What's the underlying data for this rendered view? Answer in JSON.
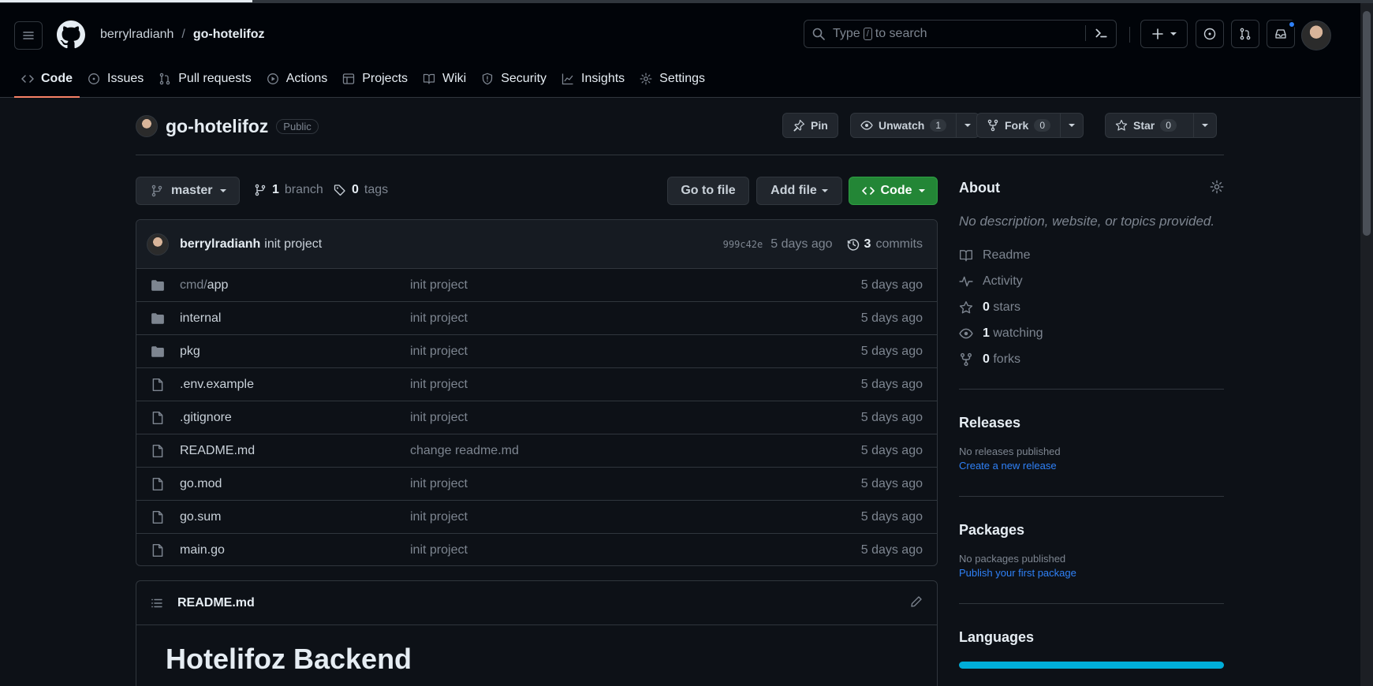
{
  "header": {
    "owner": "berrylradianh",
    "separator": "/",
    "repo": "go-hotelifoz",
    "search_prefix": "Type",
    "search_key": "/",
    "search_suffix": "to search"
  },
  "nav": [
    {
      "label": "Code",
      "icon": "code-icon"
    },
    {
      "label": "Issues",
      "icon": "issue-icon"
    },
    {
      "label": "Pull requests",
      "icon": "pull-request-icon"
    },
    {
      "label": "Actions",
      "icon": "play-icon"
    },
    {
      "label": "Projects",
      "icon": "table-icon"
    },
    {
      "label": "Wiki",
      "icon": "book-icon"
    },
    {
      "label": "Security",
      "icon": "shield-icon"
    },
    {
      "label": "Insights",
      "icon": "graph-icon"
    },
    {
      "label": "Settings",
      "icon": "gear-icon"
    }
  ],
  "repo": {
    "name": "go-hotelifoz",
    "visibility": "Public",
    "pin_label": "Pin",
    "unwatch_label": "Unwatch",
    "unwatch_count": "1",
    "fork_label": "Fork",
    "fork_count": "0",
    "star_label": "Star",
    "star_count": "0"
  },
  "branch_bar": {
    "branch": "master",
    "branch_count": "1",
    "branch_word": "branch",
    "tag_count": "0",
    "tag_word": "tags",
    "goto_file": "Go to file",
    "add_file": "Add file",
    "code": "Code"
  },
  "commit": {
    "author": "berrylradianh",
    "message": "init project",
    "sha": "999c42e",
    "age": "5 days ago",
    "count": "3",
    "count_word": "commits"
  },
  "files": [
    {
      "type": "dir",
      "prefix": "cmd/",
      "name": "app",
      "message": "init project",
      "age": "5 days ago"
    },
    {
      "type": "dir",
      "prefix": "",
      "name": "internal",
      "message": "init project",
      "age": "5 days ago"
    },
    {
      "type": "dir",
      "prefix": "",
      "name": "pkg",
      "message": "init project",
      "age": "5 days ago"
    },
    {
      "type": "file",
      "prefix": "",
      "name": ".env.example",
      "message": "init project",
      "age": "5 days ago"
    },
    {
      "type": "file",
      "prefix": "",
      "name": ".gitignore",
      "message": "init project",
      "age": "5 days ago"
    },
    {
      "type": "file",
      "prefix": "",
      "name": "README.md",
      "message": "change readme.md",
      "age": "5 days ago"
    },
    {
      "type": "file",
      "prefix": "",
      "name": "go.mod",
      "message": "init project",
      "age": "5 days ago"
    },
    {
      "type": "file",
      "prefix": "",
      "name": "go.sum",
      "message": "init project",
      "age": "5 days ago"
    },
    {
      "type": "file",
      "prefix": "",
      "name": "main.go",
      "message": "init project",
      "age": "5 days ago"
    }
  ],
  "readme": {
    "filename": "README.md",
    "heading": "Hotelifoz Backend"
  },
  "about": {
    "title": "About",
    "description": "No description, website, or topics provided.",
    "readme": "Readme",
    "activity": "Activity",
    "stars_count": "0",
    "stars_word": "stars",
    "watching_count": "1",
    "watching_word": "watching",
    "forks_count": "0",
    "forks_word": "forks"
  },
  "releases": {
    "title": "Releases",
    "empty": "No releases published",
    "link": "Create a new release"
  },
  "packages": {
    "title": "Packages",
    "empty": "No packages published",
    "link": "Publish your first package"
  },
  "languages": {
    "title": "Languages",
    "bar_color": "#00add8"
  },
  "colors": {
    "accent_green": "#238636",
    "link_blue": "#2f81f7",
    "active_tab": "#f78166"
  }
}
